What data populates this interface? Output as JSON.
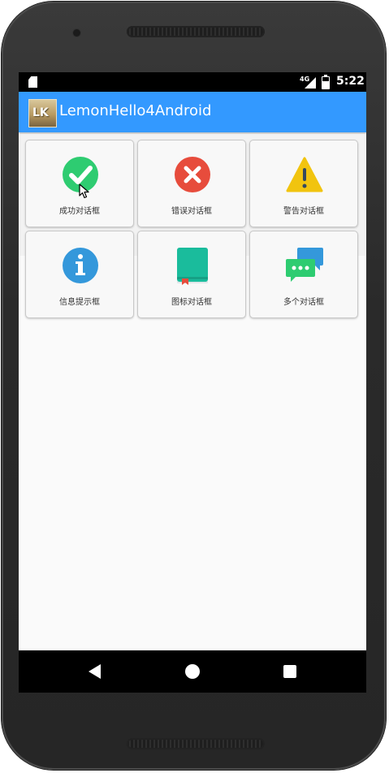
{
  "status_bar": {
    "network": "4G",
    "time": "5:22"
  },
  "app_bar": {
    "logo_text": "LK",
    "title": "LemonHello4Android"
  },
  "dialog_buttons": [
    {
      "label": "成功对话框",
      "icon": "success-check-icon",
      "color": "#2ecc71"
    },
    {
      "label": "错误对话框",
      "icon": "error-x-icon",
      "color": "#e74c3c"
    },
    {
      "label": "警告对话框",
      "icon": "warning-triangle-icon",
      "color": "#f1c40f"
    },
    {
      "label": "信息提示框",
      "icon": "info-icon",
      "color": "#3498db"
    },
    {
      "label": "图标对话框",
      "icon": "book-icon",
      "color": "#1abc9c"
    },
    {
      "label": "多个对话框",
      "icon": "chat-bubbles-icon",
      "color": "#2ecc71"
    }
  ],
  "nav_bar": {
    "back": "back-icon",
    "home": "home-icon",
    "recents": "recents-icon"
  },
  "colors": {
    "accent": "#3399ff",
    "status_bar": "#000000",
    "background": "#fafafa"
  }
}
